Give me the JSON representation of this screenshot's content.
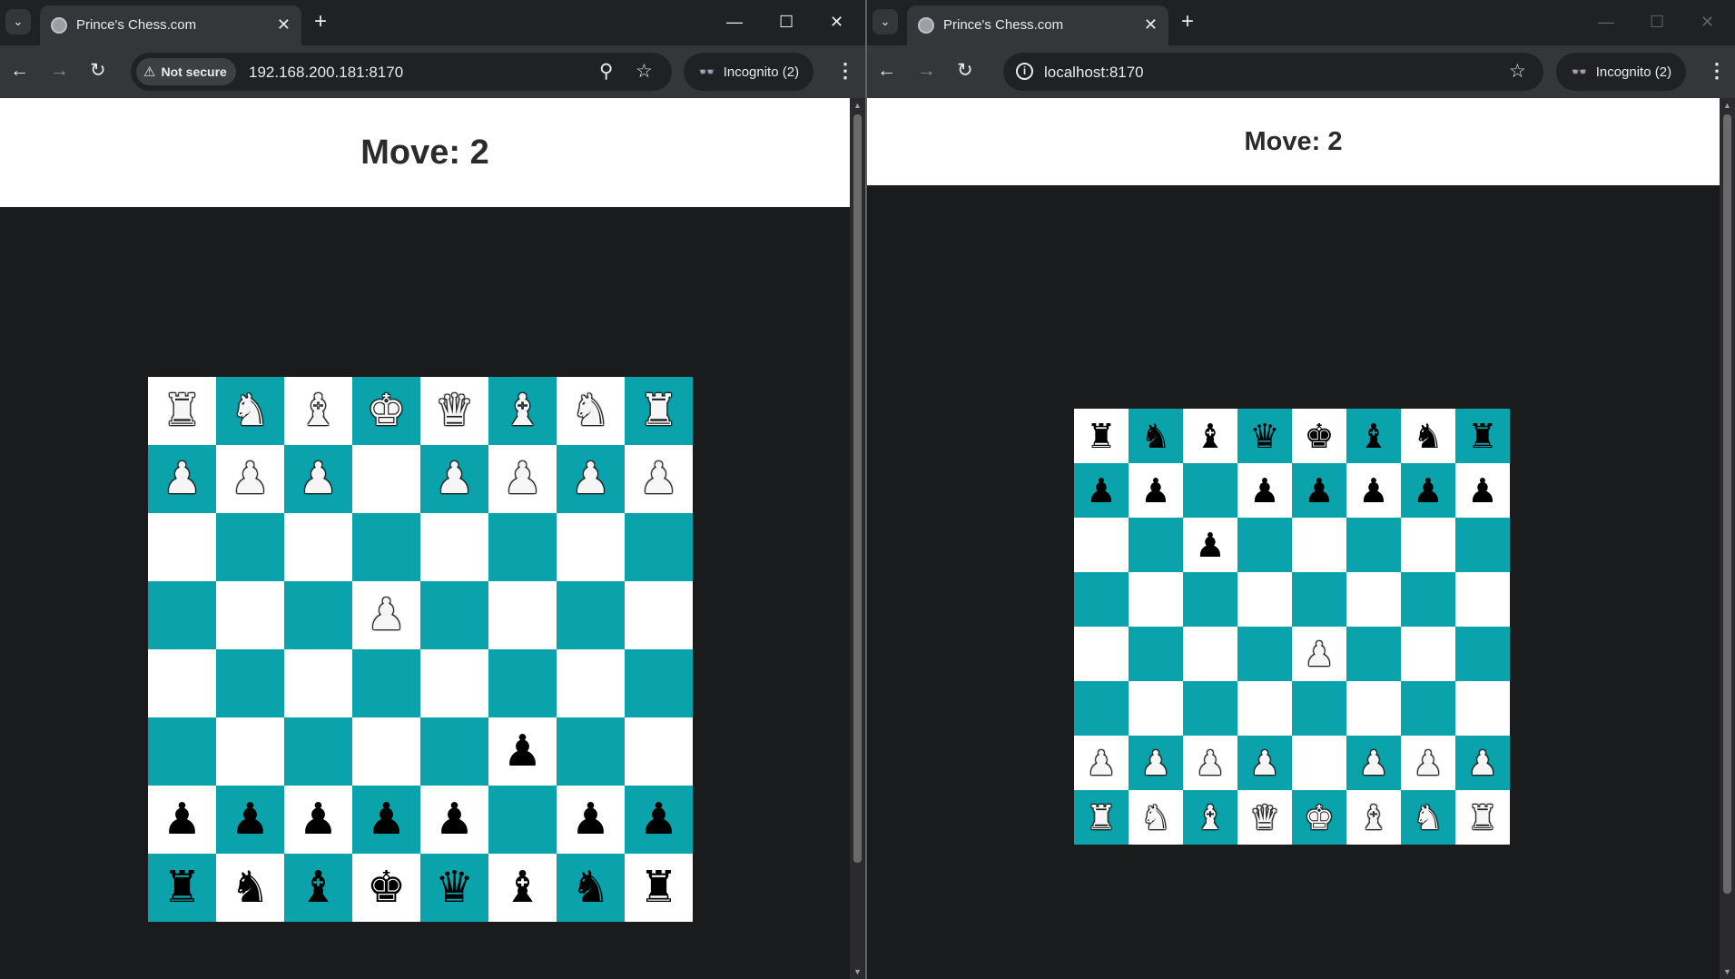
{
  "left_window": {
    "tab_title": "Prince's Chess.com",
    "security_chip": "Not secure",
    "url": "192.168.200.181:8170",
    "incognito_label": "Incognito (2)",
    "move_label": "Move: 2",
    "board_rows": [
      [
        "wR",
        "wN",
        "wB",
        "wK",
        "wQ",
        "wB",
        "wN",
        "wR"
      ],
      [
        "wP",
        "wP",
        "wP",
        "",
        "wP",
        "wP",
        "wP",
        "wP"
      ],
      [
        "",
        "",
        "",
        "",
        "",
        "",
        "",
        ""
      ],
      [
        "",
        "",
        "",
        "wP",
        "",
        "",
        "",
        ""
      ],
      [
        "",
        "",
        "",
        "",
        "",
        "",
        "",
        ""
      ],
      [
        "",
        "",
        "",
        "",
        "",
        "bP",
        "",
        ""
      ],
      [
        "bP",
        "bP",
        "bP",
        "bP",
        "bP",
        "",
        "bP",
        "bP"
      ],
      [
        "bR",
        "bN",
        "bB",
        "bK",
        "bQ",
        "bB",
        "bN",
        "bR"
      ]
    ]
  },
  "right_window": {
    "tab_title": "Prince's Chess.com",
    "url": "localhost:8170",
    "incognito_label": "Incognito (2)",
    "move_label": "Move: 2",
    "board_rows": [
      [
        "bR",
        "bN",
        "bB",
        "bQ",
        "bK",
        "bB",
        "bN",
        "bR"
      ],
      [
        "bP",
        "bP",
        "",
        "bP",
        "bP",
        "bP",
        "bP",
        "bP"
      ],
      [
        "",
        "",
        "bP",
        "",
        "",
        "",
        "",
        ""
      ],
      [
        "",
        "",
        "",
        "",
        "",
        "",
        "",
        ""
      ],
      [
        "",
        "",
        "",
        "",
        "wP",
        "",
        "",
        ""
      ],
      [
        "",
        "",
        "",
        "",
        "",
        "",
        "",
        ""
      ],
      [
        "wP",
        "wP",
        "wP",
        "wP",
        "",
        "wP",
        "wP",
        "wP"
      ],
      [
        "wR",
        "wN",
        "wB",
        "wQ",
        "wK",
        "wB",
        "wN",
        "wR"
      ]
    ]
  },
  "colors": {
    "board_dark": "#0aa2ab",
    "board_light": "#ffffff",
    "page_background": "#1a1b1d",
    "header_background": "#ffffff"
  },
  "icons": {
    "tab_favicon": "globe-icon",
    "tab_close": "close-icon",
    "new_tab": "plus-icon",
    "back": "arrow-left-icon",
    "forward": "arrow-right-icon",
    "reload": "reload-icon",
    "security_warning": "warning-triangle-icon",
    "site_info": "info-icon",
    "zoom": "zoom-icon",
    "bookmark": "star-icon",
    "incognito": "incognito-icon",
    "menu": "kebab-menu-icon"
  }
}
